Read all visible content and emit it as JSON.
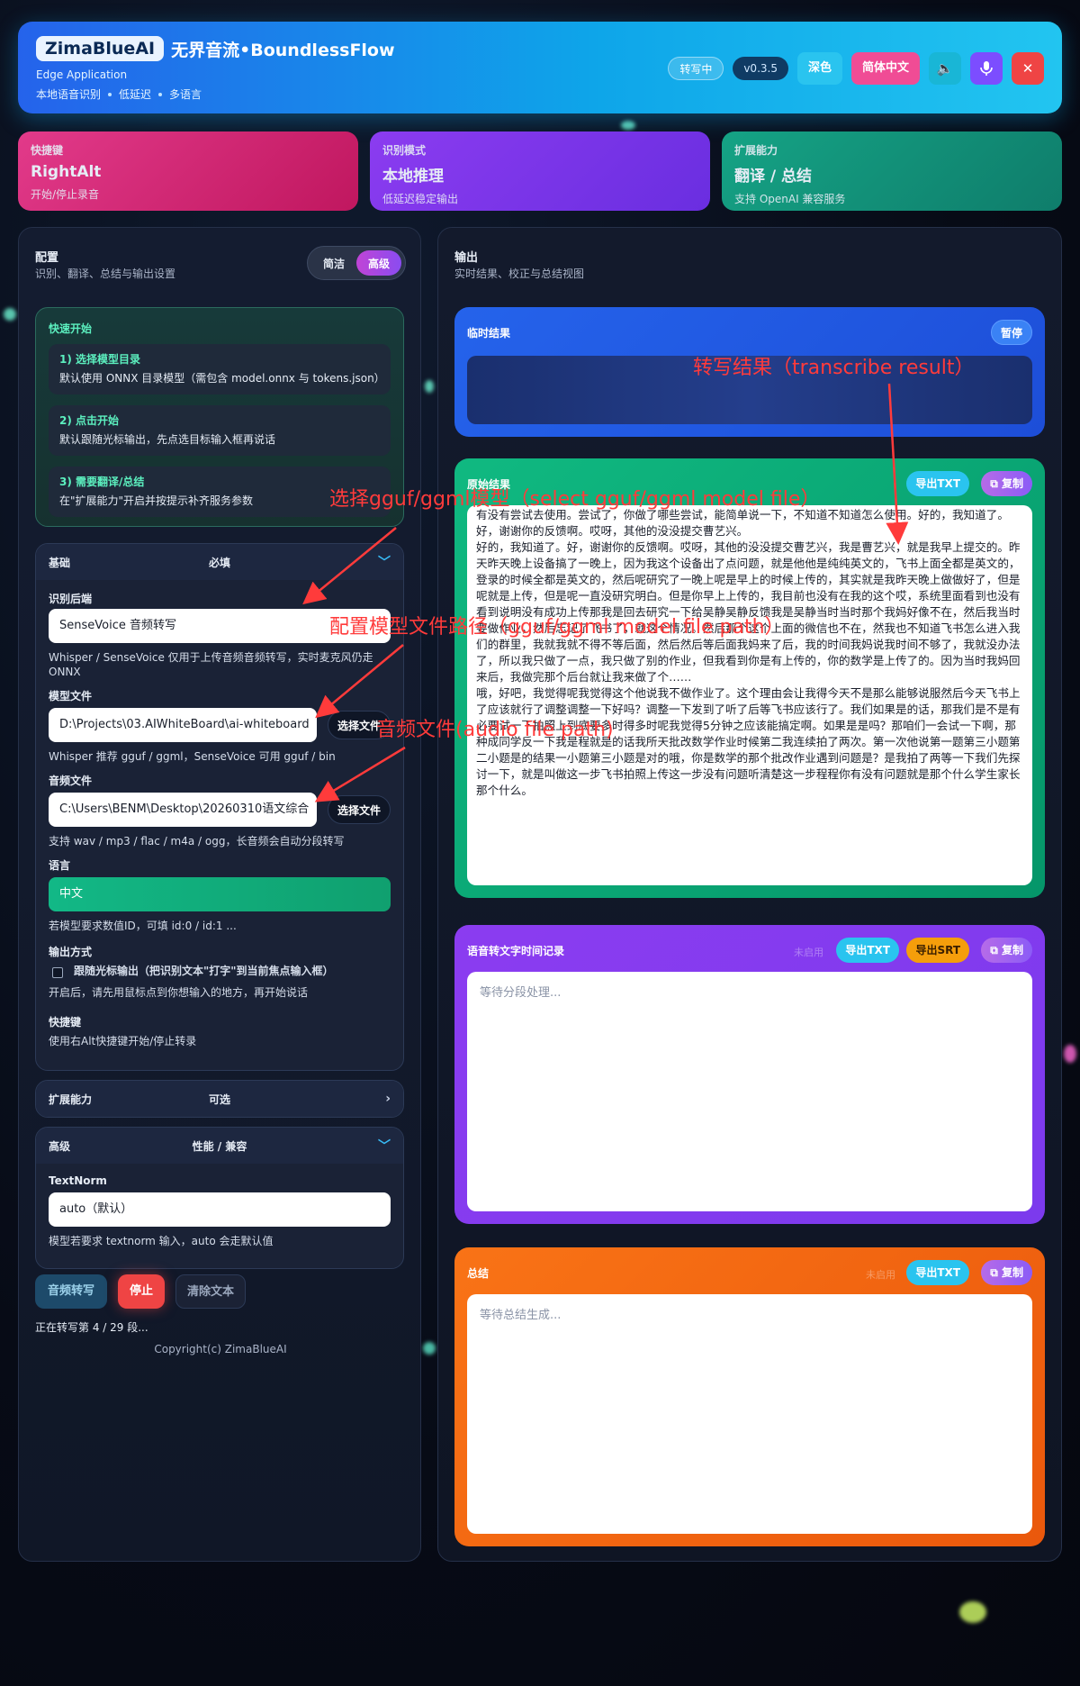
{
  "header": {
    "badge": "ZimaBlueAI",
    "title": "无界音流•BoundlessFlow",
    "subtitle": "Edge Application",
    "tags": [
      "本地语音识别",
      "低延迟",
      "多语言"
    ],
    "status": "转写中",
    "version": "v0.3.5",
    "theme_btn": "深色",
    "lang_btn": "简体中文",
    "icons": [
      "speaker-icon",
      "mic-icon",
      "close-icon"
    ]
  },
  "features": [
    {
      "key": "快捷键",
      "value": "RightAlt",
      "desc": "开始/停止录音"
    },
    {
      "key": "识别模式",
      "value": "本地推理",
      "desc": "低延迟稳定输出"
    },
    {
      "key": "扩展能力",
      "value": "翻译 / 总结",
      "desc": "支持 OpenAI 兼容服务"
    }
  ],
  "config": {
    "title": "配置",
    "subtitle": "识别、翻译、总结与输出设置",
    "mode_simple": "简洁",
    "mode_advanced": "高级",
    "quick": {
      "title": "快速开始",
      "steps": [
        {
          "t": "1) 选择模型目录",
          "d": "默认使用 ONNX 目录模型（需包含 model.onnx 与 tokens.json）"
        },
        {
          "t": "2) 点击开始",
          "d": "默认跟随光标输出，先点选目标输入框再说话"
        },
        {
          "t": "3) 需要翻译/总结",
          "d": "在\"扩展能力\"开启并按提示补齐服务参数"
        }
      ]
    },
    "basic": {
      "head": "基础",
      "head_mid": "必填",
      "backend_label": "识别后端",
      "backend_value": "SenseVoice 音频转写",
      "backend_hint": "Whisper / SenseVoice 仅用于上传音频音频转写，实时麦克风仍走 ONNX",
      "model_label": "模型文件",
      "model_value": "D:\\Projects\\03.AIWhiteBoard\\ai-whiteboard",
      "choose_file": "选择文件",
      "model_hint": "Whisper 推荐 gguf / ggml，SenseVoice 可用 gguf / bin",
      "audio_label": "音频文件",
      "audio_value": "C:\\Users\\BENM\\Desktop\\20260310语文综合",
      "audio_hint": "支持 wav / mp3 / flac / m4a / ogg，长音频会自动分段转写",
      "lang_label": "语言",
      "lang_value": "中文",
      "lang_hint": "若模型要求数值ID，可填 id:0 / id:1 ...",
      "output_label": "输出方式",
      "output_check": "跟随光标输出（把识别文本\"打字\"到当前焦点输入框）",
      "output_hint": "开启后，请先用鼠标点到你想输入的地方，再开始说话",
      "hotkey_label": "快捷键",
      "hotkey_hint": "使用右Alt快捷键开始/停止转录"
    },
    "ext": {
      "head": "扩展能力",
      "head_mid": "可选"
    },
    "adv": {
      "head": "高级",
      "head_mid": "性能 / 兼容",
      "textnorm_label": "TextNorm",
      "textnorm_value": "auto（默认）",
      "textnorm_hint": "模型若要求 textnorm 输入，auto 会走默认值"
    },
    "actions": {
      "transcribe": "音频转写",
      "stop": "停止",
      "clear": "清除文本"
    },
    "progress": "正在转写第 4 / 29 段...",
    "copyright": "Copyright(c) ZimaBlueAI"
  },
  "output": {
    "title": "输出",
    "subtitle": "实时结果、校正与总结视图",
    "temp": {
      "title": "临时结果",
      "pause": "暂停"
    },
    "raw": {
      "title": "原始结果",
      "export_txt": "导出TXT",
      "copy": "复制",
      "text": "有没有尝试去使用。尝试了，你做了哪些尝试，能简单说一下，不知道不知道怎么使用。好的，我知道了。好，谢谢你的反馈啊。哎呀，其他的没没提交曹艺兴。\n好的，我知道了。好，谢谢你的反馈啊。哎呀，其他的没没提交曹艺兴，我是曹艺兴，就是我早上提交的。昨天昨天晚上设备搞了一晚上，因为我这个设备出了点问题，就是他他是纯纯英文的，飞书上面全都是英文的，登录的时候全都是英文的，然后呢研究了一晚上呢是早上的时候上传的，其实就是我昨天晚上做做好了，但是呢就是上传，但是呢一直没研究明白。但是你早上上传的，我目前也没有在我的这个哎，系统里面看到也没有看到说明没有成功上传那我是回去研究一下给吴静吴静反馈我是吴静当时当时那个我妈好像不在，然后我当时要做作业，然后忘记了飞书了，就这个情况。然后那个这个上面的微信也不在，然我也不知道飞书怎么进入我们的群里，我就我就不得不等后面，然后然后等后面我妈来了后，我的时间我妈说我时间不够了，我就没办法了，所以我只做了一点，我只做了别的作业，但我看到你是有上传的，你的数学是上传了的。因为当时我妈回来后，我做完那个后台就让我来做了个……\n哦，好吧，我觉得呢我觉得这个他说我不做作业了。这个理由会让我得今天不是那么能够说服然后今天飞书上了应该就行了调整调整一下好吗？调整一下发到了听了后等飞书应该行了。我们如果是的话，那我们是不是有必要试一下拍照上到底要多时得多时呢我觉得5分钟之应该能搞定啊。如果是是吗？那咱们一会试一下啊，那种成同学反一下我是程就是的话我所天批改数学作业时候第二我连续拍了两次。第一次他说第一题第三小题第二小题是的结果一小题第三小题是对的哦，你是数学的那个批改作业遇到问题是？是我拍了两等一下我们先探讨一下，就是叫做这一步飞书拍照上传这一步没有问题听清楚这一步程程你有没有问题就是那个什么学生家长那个什么。"
    },
    "timeline": {
      "title": "语音转文字时间记录",
      "meta": "未启用",
      "export_txt": "导出TXT",
      "export_srt": "导出SRT",
      "copy": "复制",
      "placeholder": "等待分段处理..."
    },
    "summary": {
      "title": "总结",
      "meta": "未启用",
      "export_txt": "导出TXT",
      "copy": "复制",
      "placeholder": "等待总结生成..."
    }
  },
  "annotations": {
    "transcribe": "转写结果（transcribe result）",
    "select_model": "选择gguf/ggml模型（select gguf/ggml model file）",
    "model_path": "配置模型文件路径（gguf/ggml model file path）",
    "audio_path": "音频文件(audio file path)"
  }
}
